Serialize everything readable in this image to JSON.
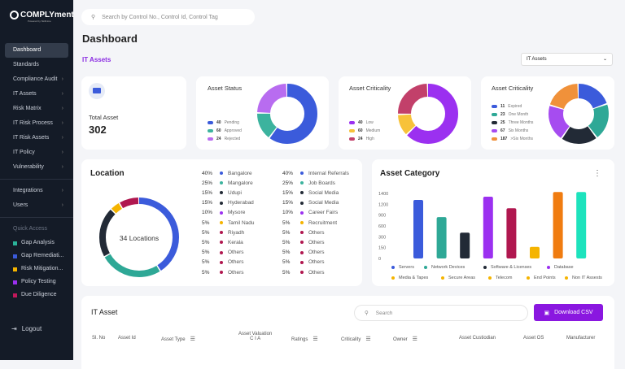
{
  "app": {
    "logo": "COMPLYment",
    "logo_tagline": "Powered by Skillmine"
  },
  "sidebar": {
    "items": [
      {
        "label": "Dashboard",
        "active": true,
        "chevron": false
      },
      {
        "label": "Standards",
        "chevron": false
      },
      {
        "label": "Compliance Audit",
        "chevron": true
      },
      {
        "label": "IT Assets",
        "chevron": true
      },
      {
        "label": "Risk Matrix",
        "chevron": true
      },
      {
        "label": "IT Risk Process",
        "chevron": true
      },
      {
        "label": "IT Risk Assets",
        "chevron": true
      },
      {
        "label": "IT Policy",
        "chevron": true
      },
      {
        "label": "Vulnerability",
        "chevron": true
      }
    ],
    "items2": [
      {
        "label": "Integrations"
      },
      {
        "label": "Users"
      }
    ],
    "quick_access_title": "Quick Access",
    "quick": [
      {
        "label": "Gap Analysis",
        "color": "#2bb39a"
      },
      {
        "label": "Gap Remediati...",
        "color": "#3b5bdb"
      },
      {
        "label": "Risk Mitigation...",
        "color": "#f5b400"
      },
      {
        "label": "Policy Testing",
        "color": "#9b30f0"
      },
      {
        "label": "Due Diligence",
        "color": "#c2185b"
      }
    ],
    "logout": "Logout"
  },
  "search": {
    "placeholder": "Search by Control No., Control Id, Control Tag"
  },
  "page": {
    "title": "Dashboard",
    "section": "IT Assets",
    "filter": "IT Assets"
  },
  "total": {
    "label": "Total Asset",
    "value": "302",
    "icon": "laptop-icon"
  },
  "status": {
    "title": "Asset Status",
    "legend": [
      {
        "n": "40",
        "l": "Pending",
        "c": "#3b5bdb",
        "v": 40
      },
      {
        "n": "60",
        "l": "Approved",
        "c": "#3cb39e",
        "v": 10
      },
      {
        "n": "24",
        "l": "Rejected",
        "c": "#b86cf0",
        "v": 16
      }
    ]
  },
  "crit": {
    "title": "Asset Criticality",
    "legend": [
      {
        "n": "40",
        "l": "Low",
        "c": "#9b30f0",
        "v": 63
      },
      {
        "n": "60",
        "l": "Medium",
        "c": "#f7c23a",
        "v": 12
      },
      {
        "n": "24",
        "l": "High",
        "c": "#c2406a",
        "v": 25
      }
    ]
  },
  "crit2": {
    "title": "Asset Criticality",
    "legend": [
      {
        "n": "11",
        "l": "Expired",
        "c": "#3b5bdb",
        "v": 20
      },
      {
        "n": "23",
        "l": "One Month",
        "c": "#2ea896",
        "v": 20
      },
      {
        "n": "25",
        "l": "Three Months",
        "c": "#222a36",
        "v": 20
      },
      {
        "n": "67",
        "l": "Six Months",
        "c": "#a64cf0",
        "v": 20
      },
      {
        "n": "187",
        "l": ">Six Months",
        "c": "#f0913a",
        "v": 20
      }
    ]
  },
  "location": {
    "title": "Location",
    "center": "34 Locations",
    "col1": [
      [
        "40%",
        "Bangalore",
        "#3b5bdb"
      ],
      [
        "25%",
        "Mangalore",
        "#3cb39e"
      ],
      [
        "15%",
        "Udupi",
        "#222a36"
      ],
      [
        "15%",
        "Hyderabad",
        "#222a36"
      ],
      [
        "10%",
        "Mysore",
        "#9b30f0"
      ],
      [
        "5%",
        "Tamil Nadu",
        "#f5b400"
      ],
      [
        "5%",
        "Riyadh",
        "#b0174f"
      ],
      [
        "5%",
        "Kerala",
        "#b0174f"
      ],
      [
        "5%",
        "Others",
        "#b0174f"
      ],
      [
        "5%",
        "Others",
        "#b0174f"
      ],
      [
        "5%",
        "Others",
        "#b0174f"
      ]
    ],
    "col2": [
      [
        "40%",
        "Internal Referrals",
        "#3b5bdb"
      ],
      [
        "25%",
        "Job Boards",
        "#3cb39e"
      ],
      [
        "15%",
        "Social Media",
        "#222a36"
      ],
      [
        "15%",
        "Social Media",
        "#222a36"
      ],
      [
        "10%",
        "Career Fairs",
        "#9b30f0"
      ],
      [
        "5%",
        "Recruitment",
        "#f5b400"
      ],
      [
        "5%",
        "Others",
        "#b0174f"
      ],
      [
        "5%",
        "Others",
        "#b0174f"
      ],
      [
        "5%",
        "Others",
        "#b0174f"
      ],
      [
        "5%",
        "Others",
        "#b0174f"
      ],
      [
        "5%",
        "Others",
        "#b0174f"
      ]
    ],
    "donut": [
      {
        "c": "#3b5bdb",
        "v": 40
      },
      {
        "c": "#2ea896",
        "v": 25
      },
      {
        "c": "#222a36",
        "v": 20
      },
      {
        "c": "#f5b400",
        "v": 4
      },
      {
        "c": "#b0174f",
        "v": 8
      }
    ]
  },
  "chart_data": {
    "type": "bar",
    "title": "Asset Category",
    "yticks": [
      "0",
      "150",
      "300",
      "600",
      "900",
      "1200",
      "1400"
    ],
    "categories": [
      "Servers",
      "Network Devices",
      "Software & Licenses",
      "Database",
      "Media & Tapes",
      "Secure Areas",
      "Telecom",
      "End Points"
    ],
    "values": [
      1260,
      890,
      555,
      1330,
      1080,
      250,
      1430,
      1430
    ],
    "bar_colors": [
      "#3b5bdb",
      "#2ea896",
      "#222a36",
      "#9b30f0",
      "#b0174f",
      "#f5b400",
      "#f07c10",
      "#1de3bd"
    ],
    "legend": [
      [
        "Servers",
        "#3b5bdb"
      ],
      [
        "Network Devices",
        "#2ea896"
      ],
      [
        "Software & Licenses",
        "#222a36"
      ],
      [
        "Database",
        "#9b30f0"
      ],
      [
        "Media & Tapes",
        "#f5b400"
      ],
      [
        "Secure Areas",
        "#f5b400"
      ],
      [
        "Telecom",
        "#f5b400"
      ],
      [
        "End Points",
        "#f5b400"
      ],
      [
        "Non IT Assests",
        "#f5b400"
      ]
    ]
  },
  "table": {
    "title": "IT Asset",
    "search_placeholder": "Search",
    "download": "Download CSV",
    "headers": [
      {
        "l": "Sl. No"
      },
      {
        "l": "Asset Id"
      },
      {
        "l": "Asset Type",
        "f": true
      },
      {
        "l": "Asset Valuation",
        "l2": "C I A"
      },
      {
        "l": "Ratings",
        "f": true
      },
      {
        "l": "Criticality",
        "f": true
      },
      {
        "l": "Owner",
        "f": true
      },
      {
        "l": "Asset Custiodian"
      },
      {
        "l": "Asset OS"
      },
      {
        "l": "Manufacturer"
      }
    ]
  }
}
